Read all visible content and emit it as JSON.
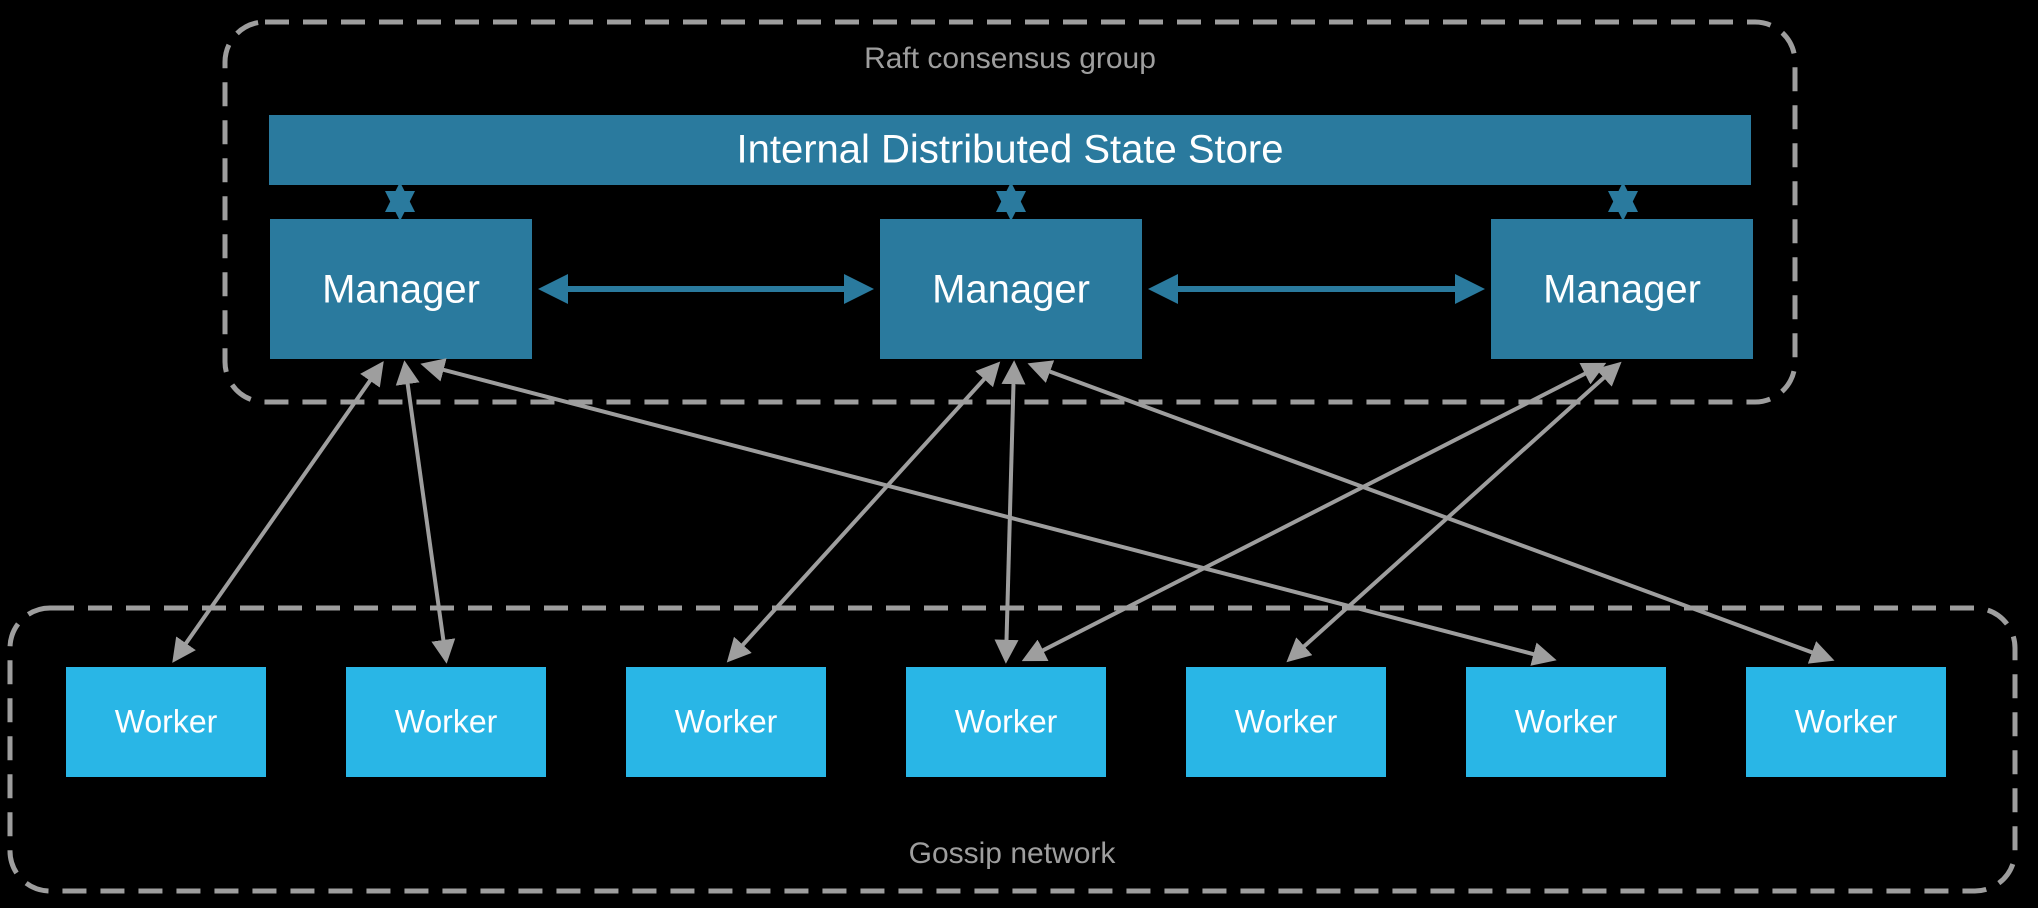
{
  "groups": {
    "raft_label": "Raft consensus group",
    "gossip_label": "Gossip network"
  },
  "store": {
    "label": "Internal Distributed State Store"
  },
  "managers": [
    {
      "label": "Manager"
    },
    {
      "label": "Manager"
    },
    {
      "label": "Manager"
    }
  ],
  "workers": [
    {
      "label": "Worker"
    },
    {
      "label": "Worker"
    },
    {
      "label": "Worker"
    },
    {
      "label": "Worker"
    },
    {
      "label": "Worker"
    },
    {
      "label": "Worker"
    },
    {
      "label": "Worker"
    }
  ]
}
